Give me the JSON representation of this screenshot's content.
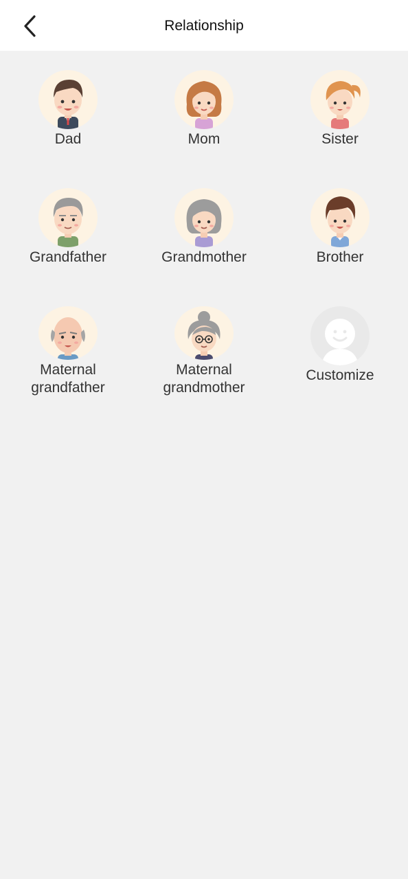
{
  "header": {
    "title": "Relationship"
  },
  "relations": [
    {
      "label": "Dad",
      "icon": "dad-avatar-icon"
    },
    {
      "label": "Mom",
      "icon": "mom-avatar-icon"
    },
    {
      "label": "Sister",
      "icon": "sister-avatar-icon"
    },
    {
      "label": "Grandfather",
      "icon": "grandfather-avatar-icon"
    },
    {
      "label": "Grandmother",
      "icon": "grandmother-avatar-icon"
    },
    {
      "label": "Brother",
      "icon": "brother-avatar-icon"
    },
    {
      "label": "Maternal grandfather",
      "icon": "maternal-grandfather-avatar-icon"
    },
    {
      "label": "Maternal grandmother",
      "icon": "maternal-grandmother-avatar-icon"
    },
    {
      "label": "Customize",
      "icon": "customize-avatar-icon"
    }
  ],
  "colors": {
    "background": "#f1f1f1",
    "header": "#ffffff",
    "avatar_bg": "#fdf3e3",
    "text": "#333333"
  }
}
